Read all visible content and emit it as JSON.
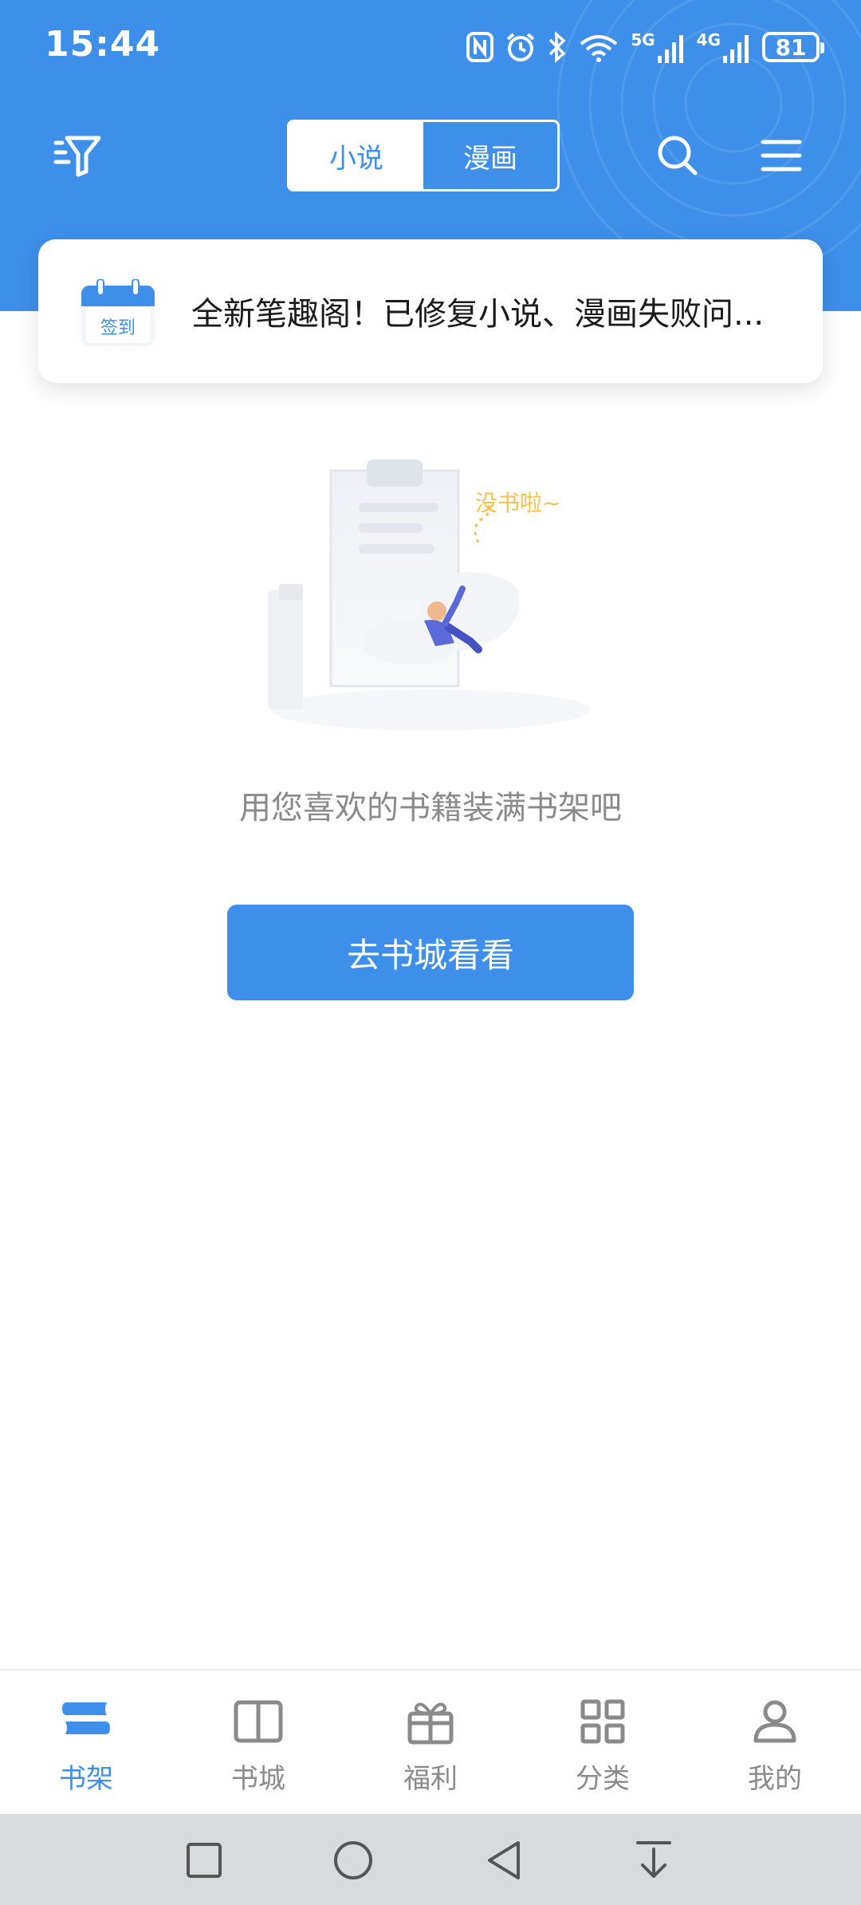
{
  "status_bar": {
    "time": "15:44",
    "network_1": "5G",
    "network_2": "4G",
    "battery": "81"
  },
  "header": {
    "tabs": [
      {
        "label": "小说",
        "active": true
      },
      {
        "label": "漫画",
        "active": false
      }
    ],
    "icons": [
      "filter-icon",
      "search-icon",
      "menu-icon"
    ],
    "accent_color": "#3d8fe9"
  },
  "notice": {
    "checkin_label": "签到",
    "text": "全新笔趣阁！已修复小说、漫画失败问..."
  },
  "empty_state": {
    "illustration_caption": "没书啦~",
    "message": "用您喜欢的书籍装满书架吧",
    "button_label": "去书城看看"
  },
  "bottom_nav": {
    "items": [
      {
        "label": "书架",
        "icon": "bookshelf-icon",
        "active": true
      },
      {
        "label": "书城",
        "icon": "open-book-icon",
        "active": false
      },
      {
        "label": "福利",
        "icon": "gift-icon",
        "active": false
      },
      {
        "label": "分类",
        "icon": "grid-icon",
        "active": false
      },
      {
        "label": "我的",
        "icon": "user-icon",
        "active": false
      }
    ]
  },
  "system_nav": {
    "icons": [
      "recents-icon",
      "home-icon",
      "back-icon",
      "notification-pull-icon"
    ]
  }
}
